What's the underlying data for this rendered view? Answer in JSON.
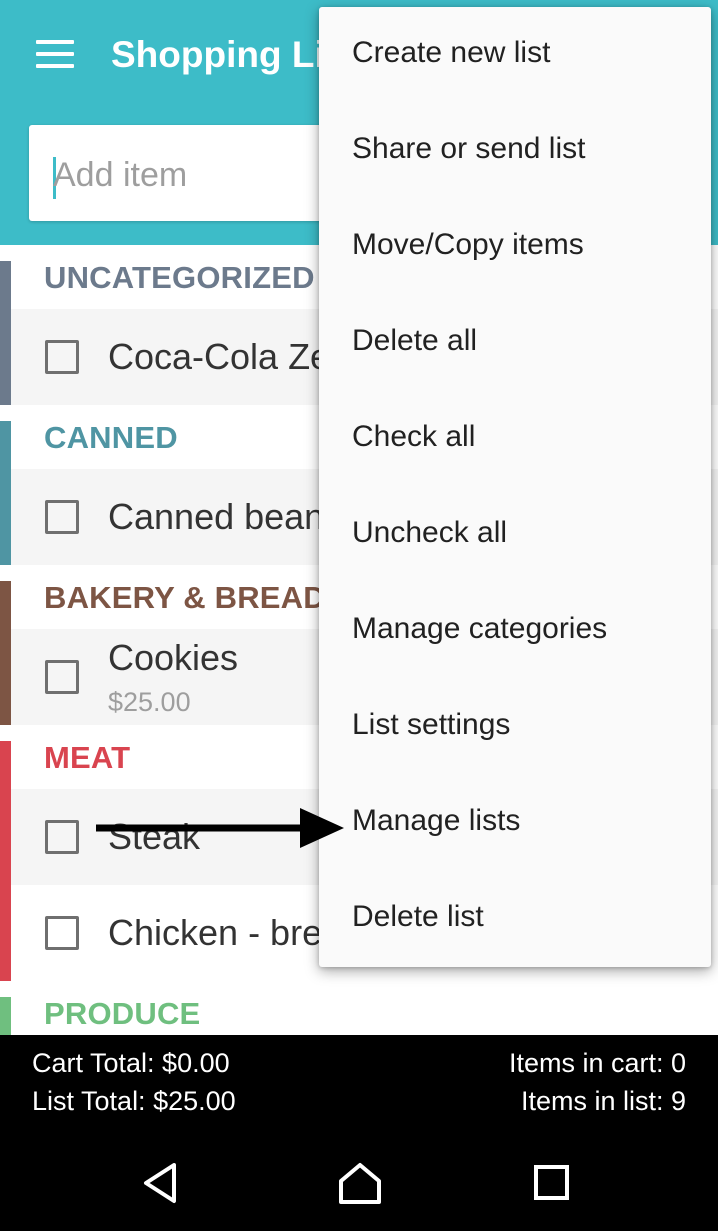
{
  "app_bar": {
    "title": "Shopping List",
    "add_item_placeholder": "Add item",
    "color": "#3dbcc8"
  },
  "categories": [
    {
      "name": "UNCATEGORIZED",
      "color": "#6c7a8c",
      "items": [
        {
          "name": "Coca-Cola Zero",
          "checked": false
        }
      ]
    },
    {
      "name": "CANNED",
      "color": "#4f95a3",
      "items": [
        {
          "name": "Canned beans",
          "checked": false
        }
      ]
    },
    {
      "name": "BAKERY & BREAD",
      "color": "#7d5544",
      "items": [
        {
          "name": "Cookies",
          "price": "$25.00",
          "checked": false
        }
      ]
    },
    {
      "name": "MEAT",
      "color": "#d9444f",
      "items": [
        {
          "name": "Steak",
          "checked": false
        },
        {
          "name": "Chicken - breast",
          "checked": false
        }
      ]
    },
    {
      "name": "PRODUCE",
      "color": "#6fbf7f",
      "items": []
    }
  ],
  "totals": {
    "cart_total": "Cart Total: $0.00",
    "list_total": "List Total: $25.00",
    "items_in_cart": "Items in cart: 0",
    "items_in_list": "Items in list: 9"
  },
  "menu": {
    "items": [
      "Create new list",
      "Share or send list",
      "Move/Copy items",
      "Delete all",
      "Check all",
      "Uncheck all",
      "Manage categories",
      "List settings",
      "Manage lists",
      "Delete list"
    ]
  },
  "annotation": {
    "arrow_target": "Manage lists",
    "arrow_icon": "right-arrow-icon"
  },
  "navbar": {
    "icons": [
      "back-icon",
      "home-icon",
      "recents-icon"
    ]
  }
}
